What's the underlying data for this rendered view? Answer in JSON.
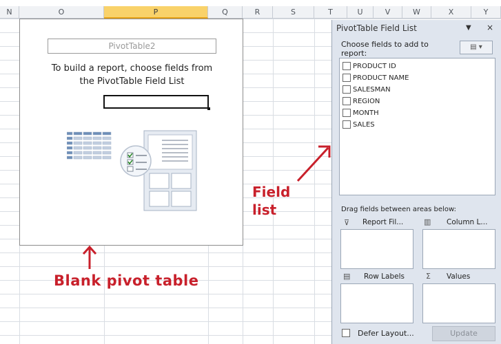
{
  "columns": [
    "N",
    "O",
    "P",
    "Q",
    "R",
    "S",
    "T",
    "U",
    "V",
    "W",
    "X",
    "Y"
  ],
  "selected_column": "P",
  "pivot": {
    "name": "PivotTable2",
    "instruction_line1": "To build a report, choose fields from",
    "instruction_line2": "the PivotTable Field List"
  },
  "field_list": {
    "title": "PivotTable Field List",
    "dropdown_glyph": "▼",
    "close_glyph": "×",
    "choose_label": "Choose fields to add to report:",
    "fields": [
      "PRODUCT ID",
      "PRODUCT NAME",
      "SALESMAN",
      "REGION",
      "MONTH",
      "SALES"
    ],
    "drag_label": "Drag fields between areas below:",
    "areas": {
      "report_filter": "Report Fil...",
      "column_labels": "Column L...",
      "row_labels": "Row Labels",
      "values": "Values"
    },
    "defer_label": "Defer Layout...",
    "update_label": "Update"
  },
  "annotations": {
    "pivot_caption": "Blank pivot table",
    "field_caption_line1": "Field",
    "field_caption_line2": "list"
  },
  "colors": {
    "annotation": "#c8202b",
    "selected_header": "#f9d26a",
    "pane_bg": "#dfe5ee"
  }
}
